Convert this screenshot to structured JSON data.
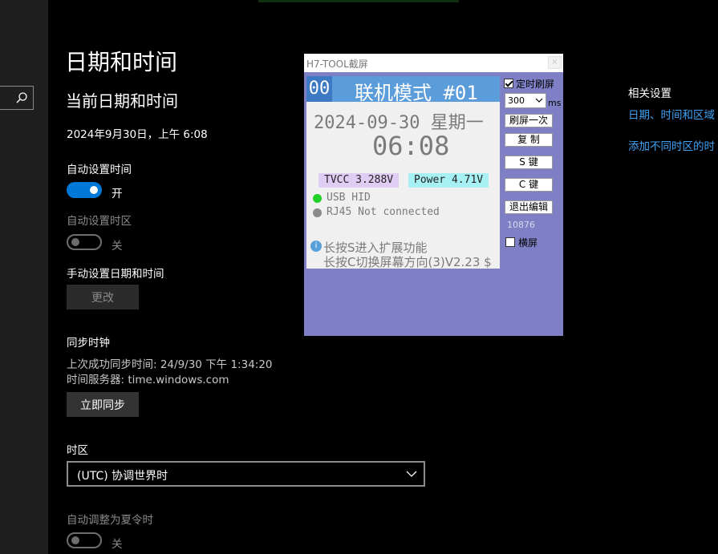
{
  "settings": {
    "title": "日期和时间",
    "section_title": "当前日期和时间",
    "current_datetime": "2024年9月30日，上午 6:08",
    "auto_time": {
      "label": "自动设置时间",
      "state": "开"
    },
    "auto_timezone": {
      "label": "自动设置时区",
      "state": "关"
    },
    "manual": {
      "label": "手动设置日期和时间",
      "button": "更改"
    },
    "sync": {
      "label": "同步时钟",
      "last_sync": "上次成功同步时间: 24/9/30 下午 1:34:20",
      "server": "时间服务器: time.windows.com",
      "button": "立即同步"
    },
    "timezone": {
      "label": "时区",
      "value": "(UTC) 协调世界时"
    },
    "dst": {
      "label": "自动调整为夏令时",
      "state": "关"
    }
  },
  "related": {
    "title": "相关设置",
    "links": [
      "日期、时间和区域",
      "添加不同时区的时"
    ]
  },
  "tool_window": {
    "title": "H7-TOOL截屏",
    "close": "×",
    "lcd": {
      "mode_num": "00",
      "mode_title": "联机模式 #01",
      "date": "2024-09-30  星期一",
      "time": "06:08",
      "tvcc": "TVCC 3.288V",
      "power": "Power 4.71V",
      "usb": "USB HID",
      "rj45": "RJ45 Not connected",
      "hint1": "长按S进入扩展功能",
      "hint2": "长按C切换屏幕方向(3)V2.23 $"
    },
    "controls": {
      "timed_refresh": "定时刷屏",
      "interval": "300",
      "unit": "ms",
      "refresh_once": "刷屏一次",
      "copy": "复 制",
      "s_key": "S 键",
      "c_key": "C 键",
      "exit_edit": "退出编辑",
      "counter": "10876",
      "landscape": "横屏"
    }
  },
  "colors": {
    "accent": "#0078d7",
    "link": "#3fa2f5",
    "tool_bg": "#7e7fc4",
    "lcd_header": "#5b9cdb",
    "usb_dot": "#22d02a",
    "rj45_dot": "#8a8a8a"
  }
}
